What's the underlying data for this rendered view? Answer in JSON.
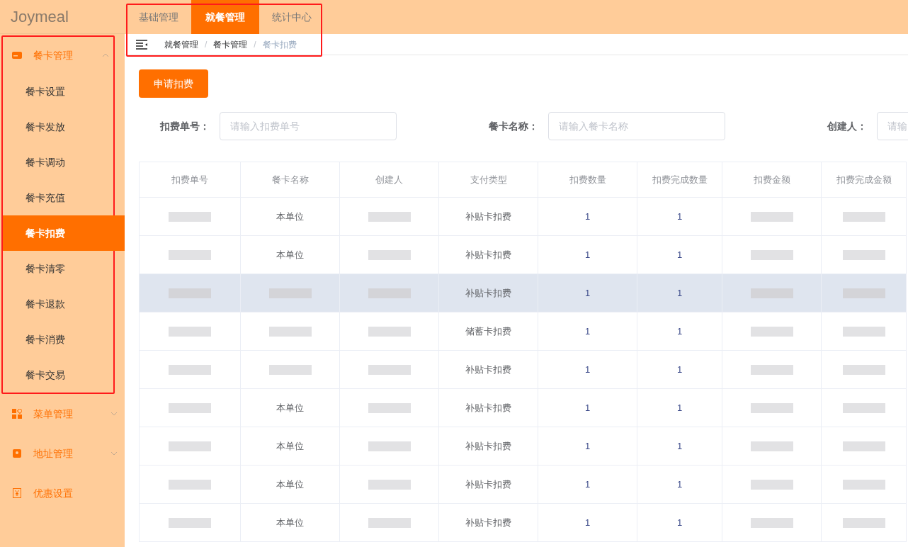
{
  "logo": "Joymeal",
  "top_nav": {
    "outlined": true,
    "tabs": [
      {
        "label": "基础管理",
        "selected": false
      },
      {
        "label": "就餐管理",
        "selected": true
      },
      {
        "label": "统计中心",
        "selected": false
      }
    ],
    "breadcrumb": [
      "就餐管理",
      "餐卡管理",
      "餐卡扣费"
    ],
    "breadcrumb_separator": "/"
  },
  "sidebar": {
    "groups": [
      {
        "label": "餐卡管理",
        "kind": "card",
        "expanded": true,
        "outlined": true,
        "children": [
          {
            "label": "餐卡设置",
            "selected": false
          },
          {
            "label": "餐卡发放",
            "selected": false
          },
          {
            "label": "餐卡调动",
            "selected": false
          },
          {
            "label": "餐卡充值",
            "selected": false
          },
          {
            "label": "餐卡扣费",
            "selected": true
          },
          {
            "label": "餐卡清零",
            "selected": false
          },
          {
            "label": "餐卡退款",
            "selected": false
          },
          {
            "label": "餐卡消费",
            "selected": false
          },
          {
            "label": "餐卡交易",
            "selected": false
          }
        ]
      },
      {
        "label": "菜单管理",
        "kind": "grid",
        "expanded": false,
        "outlined": false
      },
      {
        "label": "地址管理",
        "kind": "pin",
        "expanded": false,
        "outlined": false
      },
      {
        "label": "优惠设置",
        "kind": "coupon",
        "outlined": false
      }
    ]
  },
  "primary_button": "申请扣费",
  "filters": [
    {
      "label": "扣费单号：",
      "placeholder": "请输入扣费单号"
    },
    {
      "label": "餐卡名称：",
      "placeholder": "请输入餐卡名称"
    },
    {
      "label": "创建人：",
      "placeholder": "请输"
    }
  ],
  "table": {
    "columns": [
      "扣费单号",
      "餐卡名称",
      "创建人",
      "支付类型",
      "扣费数量",
      "扣费完成数量",
      "扣费金额",
      "扣费完成金额"
    ],
    "rows": [
      {
        "highlighted": false,
        "cells": [
          {
            "kind": "redacted"
          },
          {
            "kind": "text",
            "text": "本单位"
          },
          {
            "kind": "redacted"
          },
          {
            "kind": "text",
            "text": "补贴卡扣费"
          },
          {
            "kind": "text",
            "text": "1"
          },
          {
            "kind": "text",
            "text": "1"
          },
          {
            "kind": "redacted"
          },
          {
            "kind": "redacted"
          }
        ]
      },
      {
        "highlighted": false,
        "cells": [
          {
            "kind": "redacted"
          },
          {
            "kind": "text",
            "text": "本单位"
          },
          {
            "kind": "redacted"
          },
          {
            "kind": "text",
            "text": "补贴卡扣费"
          },
          {
            "kind": "text",
            "text": "1"
          },
          {
            "kind": "text",
            "text": "1"
          },
          {
            "kind": "redacted"
          },
          {
            "kind": "redacted"
          }
        ]
      },
      {
        "highlighted": true,
        "cells": [
          {
            "kind": "redacted"
          },
          {
            "kind": "redacted"
          },
          {
            "kind": "redacted"
          },
          {
            "kind": "text",
            "text": "补贴卡扣费"
          },
          {
            "kind": "text",
            "text": "1"
          },
          {
            "kind": "text",
            "text": "1"
          },
          {
            "kind": "redacted"
          },
          {
            "kind": "redacted"
          }
        ]
      },
      {
        "highlighted": false,
        "cells": [
          {
            "kind": "redacted"
          },
          {
            "kind": "redacted"
          },
          {
            "kind": "redacted"
          },
          {
            "kind": "text",
            "text": "储蓄卡扣费"
          },
          {
            "kind": "text",
            "text": "1"
          },
          {
            "kind": "text",
            "text": "1"
          },
          {
            "kind": "redacted"
          },
          {
            "kind": "redacted"
          }
        ]
      },
      {
        "highlighted": false,
        "cells": [
          {
            "kind": "redacted"
          },
          {
            "kind": "redacted"
          },
          {
            "kind": "redacted"
          },
          {
            "kind": "text",
            "text": "补贴卡扣费"
          },
          {
            "kind": "text",
            "text": "1"
          },
          {
            "kind": "text",
            "text": "1"
          },
          {
            "kind": "redacted"
          },
          {
            "kind": "redacted"
          }
        ]
      },
      {
        "highlighted": false,
        "cells": [
          {
            "kind": "redacted"
          },
          {
            "kind": "text",
            "text": "本单位"
          },
          {
            "kind": "redacted"
          },
          {
            "kind": "text",
            "text": "补贴卡扣费"
          },
          {
            "kind": "text",
            "text": "1"
          },
          {
            "kind": "text",
            "text": "1"
          },
          {
            "kind": "redacted"
          },
          {
            "kind": "redacted"
          }
        ]
      },
      {
        "highlighted": false,
        "cells": [
          {
            "kind": "redacted"
          },
          {
            "kind": "text",
            "text": "本单位"
          },
          {
            "kind": "redacted"
          },
          {
            "kind": "text",
            "text": "补贴卡扣费"
          },
          {
            "kind": "text",
            "text": "1"
          },
          {
            "kind": "text",
            "text": "1"
          },
          {
            "kind": "redacted"
          },
          {
            "kind": "redacted"
          }
        ]
      },
      {
        "highlighted": false,
        "cells": [
          {
            "kind": "redacted"
          },
          {
            "kind": "text",
            "text": "本单位"
          },
          {
            "kind": "redacted"
          },
          {
            "kind": "text",
            "text": "补贴卡扣费"
          },
          {
            "kind": "text",
            "text": "1"
          },
          {
            "kind": "text",
            "text": "1"
          },
          {
            "kind": "redacted"
          },
          {
            "kind": "redacted"
          }
        ]
      },
      {
        "highlighted": false,
        "cells": [
          {
            "kind": "redacted"
          },
          {
            "kind": "text",
            "text": "本单位"
          },
          {
            "kind": "redacted"
          },
          {
            "kind": "text",
            "text": "补贴卡扣费"
          },
          {
            "kind": "text",
            "text": "1"
          },
          {
            "kind": "text",
            "text": "1"
          },
          {
            "kind": "redacted"
          },
          {
            "kind": "redacted"
          }
        ]
      }
    ]
  }
}
